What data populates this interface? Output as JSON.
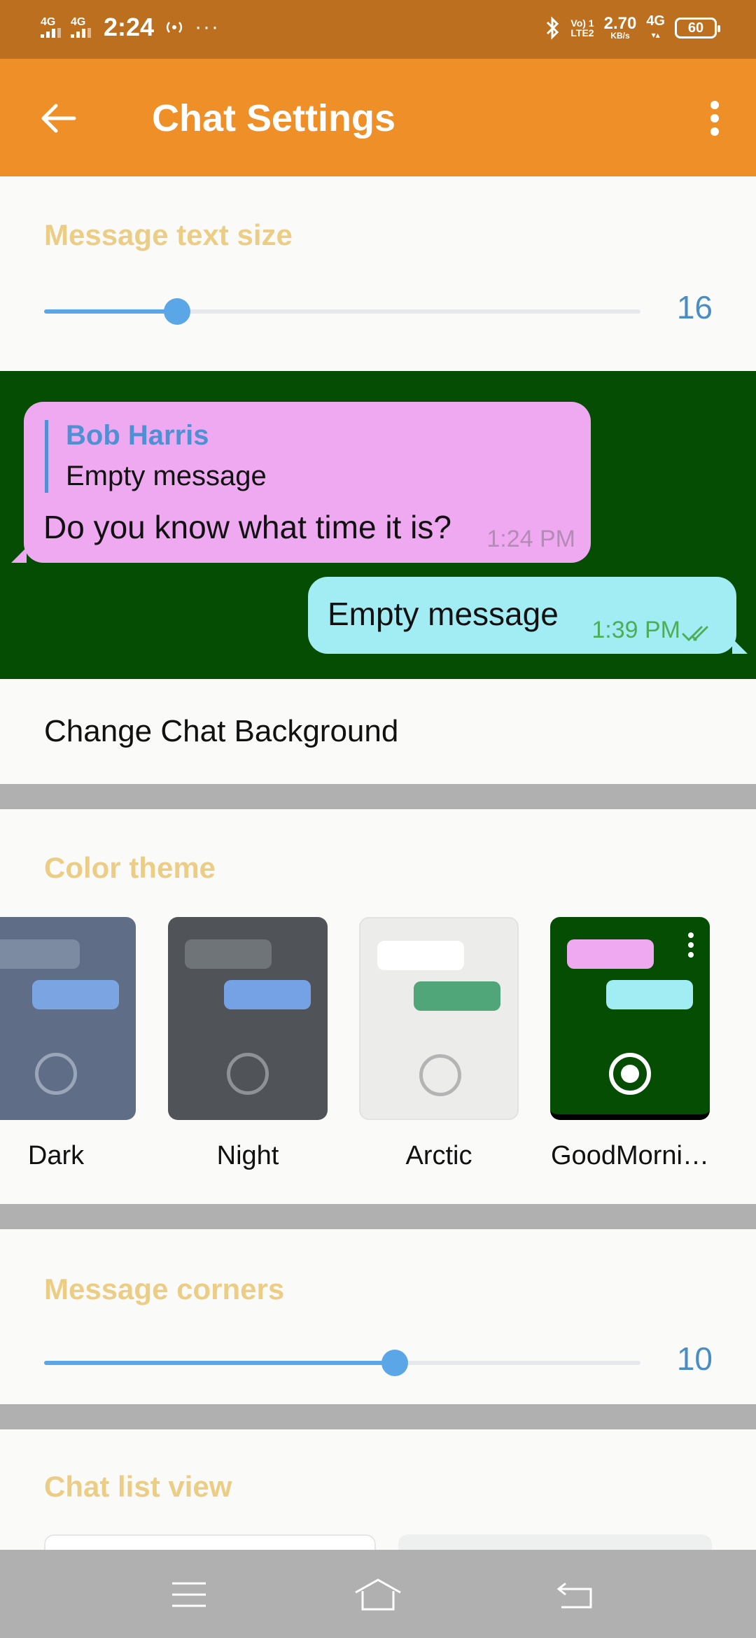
{
  "status_bar": {
    "network1": "4G",
    "network2": "4G",
    "time": "2:24",
    "overflow": "···",
    "volte_top": "Vo) 1",
    "volte_bottom": "LTE2",
    "speed_value": "2.70",
    "speed_unit": "KB/s",
    "network3": "4G",
    "battery": "60"
  },
  "app_bar": {
    "title": "Chat Settings"
  },
  "text_size": {
    "header": "Message text size",
    "value": "16",
    "fraction": 0.223
  },
  "preview": {
    "incoming": {
      "reply_name": "Bob Harris",
      "reply_text": "Empty message",
      "text": "Do you know what time it is?",
      "time": "1:24 PM"
    },
    "outgoing": {
      "text": "Empty message",
      "time": "1:39 PM"
    },
    "colors": {
      "background": "#044d02",
      "incoming": "#eea9f1",
      "outgoing": "#a2ecf3"
    }
  },
  "change_background": {
    "label": "Change Chat Background"
  },
  "color_theme": {
    "header": "Color theme",
    "themes": [
      {
        "label": "Dark",
        "selected": false
      },
      {
        "label": "Night",
        "selected": false
      },
      {
        "label": "Arctic",
        "selected": false
      },
      {
        "label": "GoodMorni…",
        "selected": true
      }
    ]
  },
  "corners": {
    "header": "Message corners",
    "value": "10",
    "fraction": 0.588
  },
  "chat_list_view": {
    "header": "Chat list view"
  },
  "accent_colors": {
    "status_bar": "#bb6f1f",
    "app_bar": "#ee9027",
    "slider": "#5aa6e6",
    "section_header": "#eccd86"
  }
}
